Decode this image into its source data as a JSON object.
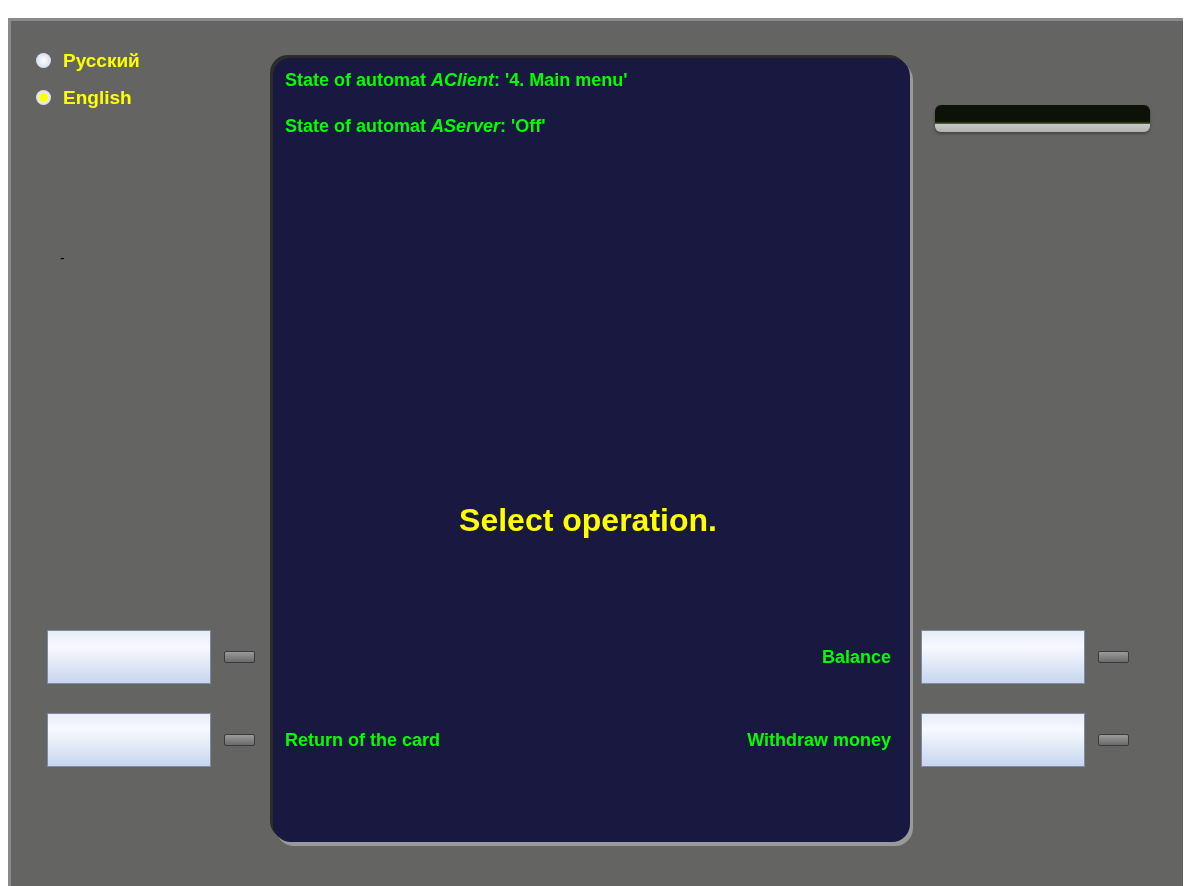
{
  "languages": [
    {
      "label": "Русский",
      "selected": false
    },
    {
      "label": "English",
      "selected": true
    }
  ],
  "side_note": "-",
  "screen": {
    "status_lines": [
      "State of automat *AClient*: '4. Main menu'",
      "State of automat *AServer*: 'Off'"
    ],
    "prompt": "Select operation.",
    "option_rows": [
      {
        "right": "Balance"
      },
      {
        "left": "Return of the card",
        "right": "Withdraw money"
      }
    ]
  }
}
